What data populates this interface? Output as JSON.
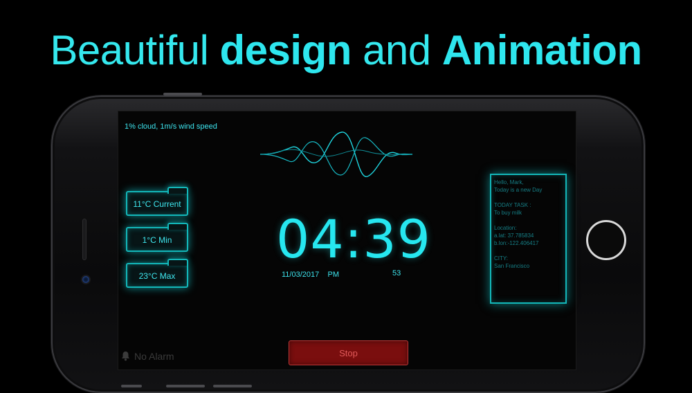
{
  "headline": {
    "part1": "Beautiful ",
    "part2": "design",
    "part3": " and ",
    "part4": "Animation"
  },
  "weather": {
    "description": "1% cloud, 1m/s wind speed",
    "current": "11°C  Current",
    "min": "1°C  Min",
    "max": "23°C  Max"
  },
  "clock": {
    "time": "04:39",
    "date": "11/03/2017",
    "ampm": "PM",
    "seconds": "53"
  },
  "message": {
    "greeting": "Hello, Mark,",
    "line2": "Today is a new Day",
    "task_header": "TODAY TASK :",
    "task": " To buy milk",
    "location_header": "Location:",
    "lat": "a.lat: 37.785834",
    "lon": "b.lon:-122.406417",
    "city_header": "CITY:",
    "city": "San Francisco"
  },
  "alarm": {
    "label": "No Alarm"
  },
  "stop": {
    "label": "Stop"
  },
  "colors": {
    "accent": "#26e7f0",
    "stop_bg": "#7a0e0e",
    "stop_text": "#e15a5a"
  }
}
